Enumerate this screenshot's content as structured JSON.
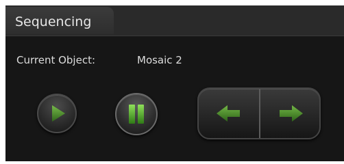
{
  "panel": {
    "title": "Sequencing"
  },
  "current_object": {
    "label": "Current Object:",
    "value": "Mosaic 2"
  },
  "controls": {
    "play_icon": "play-icon",
    "pause_icon": "pause-icon",
    "back_icon": "arrow-left-icon",
    "forward_icon": "arrow-right-icon",
    "icon_color": "#4e9a2b"
  }
}
